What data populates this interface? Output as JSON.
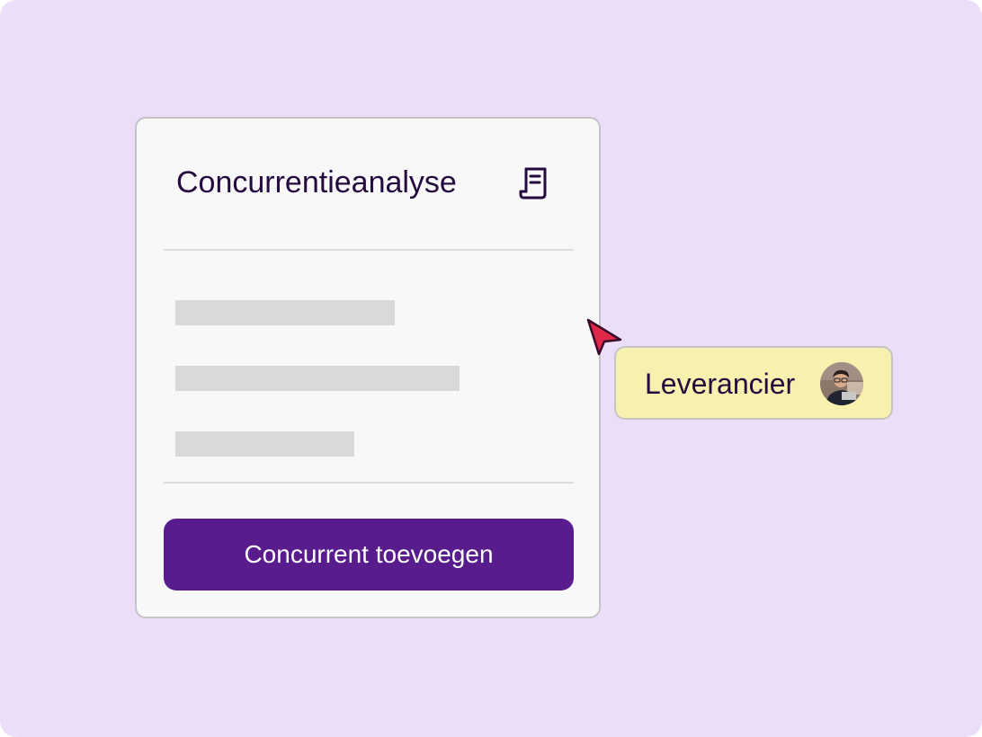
{
  "card": {
    "title": "Concurrentieanalyse",
    "title_icon": "document-icon",
    "placeholder_rows": 3,
    "button_label": "Concurrent toevoegen"
  },
  "cursor": {
    "icon": "pointer-cursor-icon",
    "color": "#e0284a"
  },
  "user_tag": {
    "label": "Leverancier",
    "avatar_icon": "user-avatar"
  },
  "colors": {
    "background": "#ecdef8",
    "card": "#f8f8f8",
    "primary": "#581c8c",
    "tag": "#f6f1ae",
    "text": "#240a3f"
  }
}
